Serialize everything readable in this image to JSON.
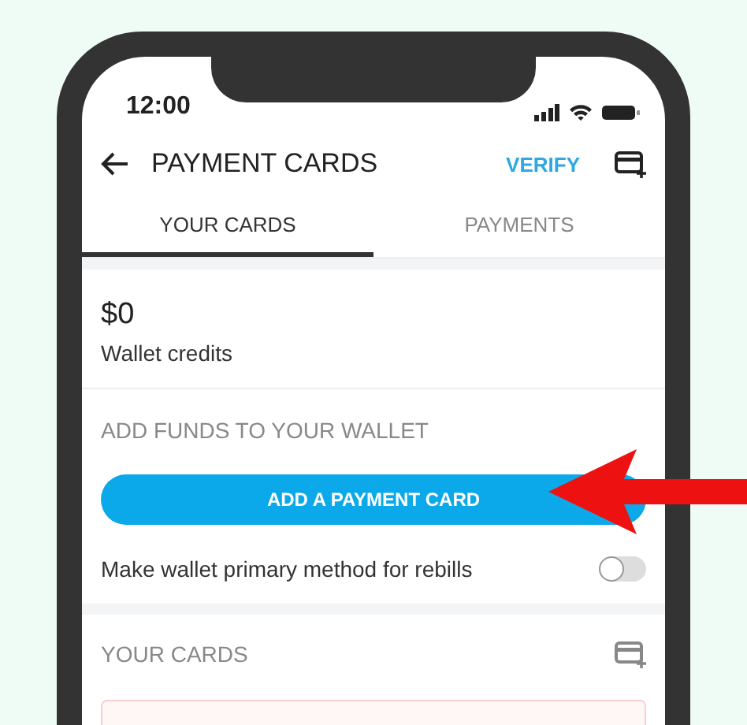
{
  "status_bar": {
    "time": "12:00"
  },
  "header": {
    "title": "PAYMENT CARDS",
    "action": "VERIFY"
  },
  "tabs": [
    {
      "label": "YOUR CARDS",
      "selected": true
    },
    {
      "label": "PAYMENTS",
      "selected": false
    }
  ],
  "wallet": {
    "amount": "$0",
    "caption": "Wallet credits"
  },
  "add_funds": {
    "heading": "ADD FUNDS TO YOUR WALLET",
    "button": "ADD A PAYMENT CARD"
  },
  "primary_toggle": {
    "label": "Make wallet primary method for rebills",
    "on": false
  },
  "cards_section": {
    "heading": "YOUR CARDS"
  }
}
